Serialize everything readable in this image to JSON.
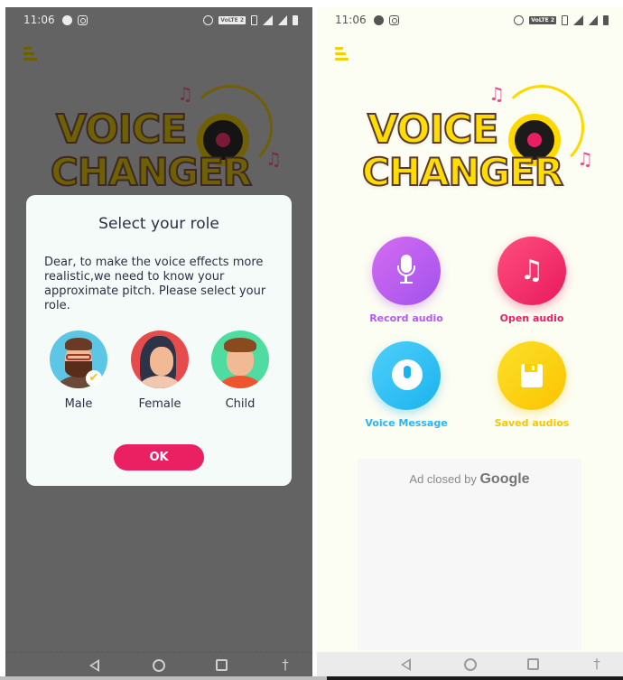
{
  "left_screen": {
    "status_bar": {
      "time": "11:06",
      "volte_label": "VoLTE 2",
      "left_icons": [
        "message-icon",
        "instagram-icon"
      ],
      "right_icons": [
        "alarm-icon",
        "volte-icon",
        "vibrate-icon",
        "signal-icon",
        "signal-4g-icon",
        "battery-icon"
      ]
    },
    "logo": {
      "line1": "VOICE",
      "line2": "CHANGER",
      "note_glyph": "♫"
    },
    "dialog": {
      "title": "Select your role",
      "body": "Dear, to make the voice effects more realistic,we need to know your approximate pitch. Please select your role.",
      "roles": [
        {
          "label": "Male",
          "selected": true
        },
        {
          "label": "Female",
          "selected": false
        },
        {
          "label": "Child",
          "selected": false
        }
      ],
      "check_glyph": "✔",
      "ok_label": "OK"
    },
    "nav_bar": {
      "accessibility_glyph": "🚶"
    }
  },
  "right_screen": {
    "status_bar": {
      "time": "11:06",
      "volte_label": "VoLTE 2"
    },
    "logo": {
      "line1": "VOICE",
      "line2": "CHANGER",
      "note_glyph": "♫"
    },
    "menu": [
      {
        "label": "Record audio",
        "icon": "microphone-icon",
        "color": "#b25bef"
      },
      {
        "label": "Open audio",
        "icon": "music-note-icon",
        "color": "#e91e63",
        "glyph": "♫"
      },
      {
        "label": "Voice Message",
        "icon": "voice-message-icon",
        "color": "#29b6f6"
      },
      {
        "label": "Saved audios",
        "icon": "floppy-disk-icon",
        "color": "#f6c600"
      }
    ],
    "ad": {
      "text": "Ad closed by",
      "brand": "Google"
    }
  }
}
